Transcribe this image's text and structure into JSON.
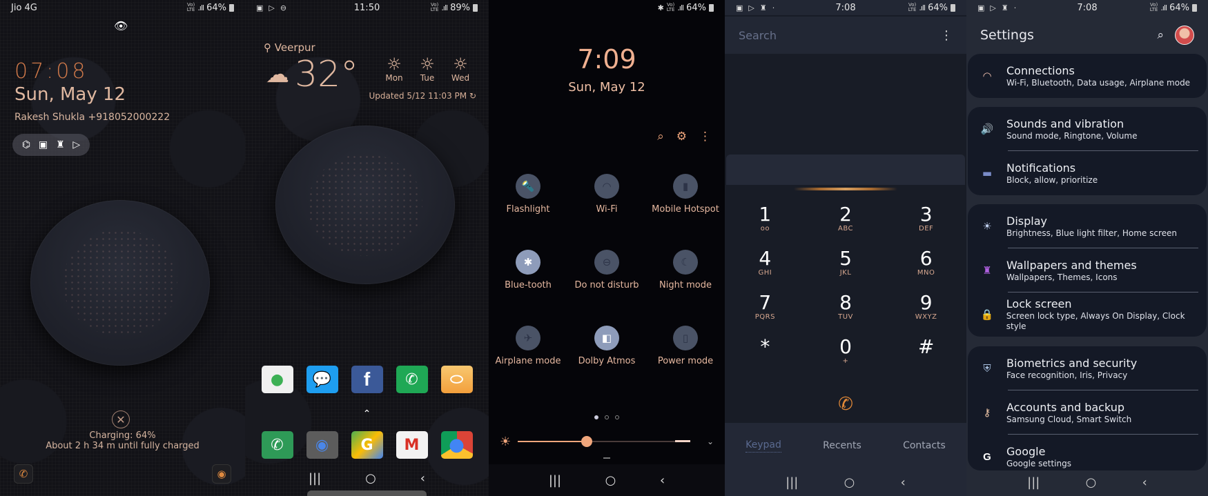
{
  "lock_screen": {
    "status": {
      "carrier": "Jio 4G",
      "network": "VoLTE LTE1 LTE",
      "battery": "64%"
    },
    "time": "07:08",
    "date": "Sun, May 12",
    "owner_info": "Rakesh Shukla +918052000222",
    "shortcuts": [
      "game-launcher-icon",
      "gallery-icon",
      "theme-brush-icon",
      "play-store-icon"
    ],
    "charging_status": "Charging: 64%",
    "charging_eta": "About 2 h 34 m until fully charged",
    "left_shortcut": "phone-icon",
    "right_shortcut": "camera-icon"
  },
  "home_screen": {
    "status": {
      "time": "11:50",
      "network": "VoLTE LTE1 LTE",
      "battery": "89%"
    },
    "weather": {
      "location": "Veerpur",
      "temperature": "32°",
      "condition": "cloudy",
      "forecast": [
        {
          "day": "Mon"
        },
        {
          "day": "Tue"
        },
        {
          "day": "Wed"
        }
      ],
      "updated": "Updated 5/12 11:03 PM"
    },
    "apps_row": [
      {
        "name": "Toggle app",
        "color": "#f0f0f0"
      },
      {
        "name": "Messages",
        "color": "#1e9ef0"
      },
      {
        "name": "Facebook",
        "color": "#3b5998"
      },
      {
        "name": "WhatsApp",
        "color": "#1fa855"
      },
      {
        "name": "Notes",
        "color": "#f3a73c"
      }
    ],
    "dock": [
      {
        "name": "Phone",
        "color": "#2e9a57"
      },
      {
        "name": "Camera",
        "color": "#5c5c5c"
      },
      {
        "name": "Google Maps",
        "color": "#4a8c4a"
      },
      {
        "name": "Gmail",
        "color": "#e04a3c"
      },
      {
        "name": "Chrome",
        "color": "#4caf50"
      }
    ]
  },
  "quick_panel": {
    "status": {
      "network": "Bluetooth VoLTE LTE1 LTE",
      "battery": "64%"
    },
    "time": "7:09",
    "date": "Sun, May 12",
    "tiles": [
      {
        "label": "Flashlight",
        "icon": "flashlight-icon",
        "on": false
      },
      {
        "label": "Wi-Fi",
        "icon": "wifi-icon",
        "on": false
      },
      {
        "label": "Mobile Hotspot",
        "icon": "hotspot-icon",
        "on": false
      },
      {
        "label": "Blue-tooth",
        "icon": "bluetooth-icon",
        "on": true
      },
      {
        "label": "Do not disturb",
        "icon": "do-not-disturb-icon",
        "on": false
      },
      {
        "label": "Night mode",
        "icon": "moon-icon",
        "on": false
      },
      {
        "label": "Airplane mode",
        "icon": "airplane-icon",
        "on": false
      },
      {
        "label": "Dolby Atmos",
        "icon": "dolby-icon",
        "on": true
      },
      {
        "label": "Power mode",
        "icon": "battery-icon",
        "on": false
      }
    ],
    "page_count": 3,
    "current_page": 1,
    "brightness": 0.4
  },
  "dialer": {
    "status": {
      "time": "7:08",
      "network": "VoLTE LTE1 LTE",
      "battery": "64%"
    },
    "search_placeholder": "Search",
    "keys": [
      {
        "digit": "1",
        "sub": "voicemail"
      },
      {
        "digit": "2",
        "sub": "ABC"
      },
      {
        "digit": "3",
        "sub": "DEF"
      },
      {
        "digit": "4",
        "sub": "GHI"
      },
      {
        "digit": "5",
        "sub": "JKL"
      },
      {
        "digit": "6",
        "sub": "MNO"
      },
      {
        "digit": "7",
        "sub": "PQRS"
      },
      {
        "digit": "8",
        "sub": "TUV"
      },
      {
        "digit": "9",
        "sub": "WXYZ"
      },
      {
        "digit": "*",
        "sub": ""
      },
      {
        "digit": "0",
        "sub": "+"
      },
      {
        "digit": "#",
        "sub": ""
      }
    ],
    "tabs": [
      "Keypad",
      "Recents",
      "Contacts"
    ],
    "active_tab": "Keypad"
  },
  "settings": {
    "status": {
      "time": "7:08",
      "network": "VoLTE LTE1 LTE",
      "battery": "64%"
    },
    "title": "Settings",
    "groups": [
      [
        {
          "title": "Connections",
          "subtitle": "Wi-Fi, Bluetooth, Data usage, Airplane mode",
          "icon": "wifi-icon",
          "icon_color": "#f0c0b0"
        }
      ],
      [
        {
          "title": "Sounds and vibration",
          "subtitle": "Sound mode, Ringtone, Volume",
          "icon": "speaker-icon",
          "icon_color": "#e8e8f0"
        },
        {
          "title": "Notifications",
          "subtitle": "Block, allow, prioritize",
          "icon": "notification-icon",
          "icon_color": "#7a8cc8"
        }
      ],
      [
        {
          "title": "Display",
          "subtitle": "Brightness, Blue light filter, Home screen",
          "icon": "sun-icon",
          "icon_color": "#c0d0f0"
        },
        {
          "title": "Wallpapers and themes",
          "subtitle": "Wallpapers, Themes, Icons",
          "icon": "brush-icon",
          "icon_color": "#b060e0"
        },
        {
          "title": "Lock screen",
          "subtitle": "Screen lock type, Always On Display, Clock style",
          "icon": "lock-icon",
          "icon_color": "#f0f0f0"
        }
      ],
      [
        {
          "title": "Biometrics and security",
          "subtitle": "Face recognition, Iris, Privacy",
          "icon": "shield-icon",
          "icon_color": "#a8c0e0"
        },
        {
          "title": "Accounts and backup",
          "subtitle": "Samsung Cloud, Smart Switch",
          "icon": "key-icon",
          "icon_color": "#f0c8a8"
        },
        {
          "title": "Google",
          "subtitle": "Google settings",
          "icon": "google-icon",
          "icon_color": "#ffffff"
        }
      ]
    ]
  },
  "nav": {
    "recents": "|||",
    "home": "○",
    "back": "‹"
  }
}
